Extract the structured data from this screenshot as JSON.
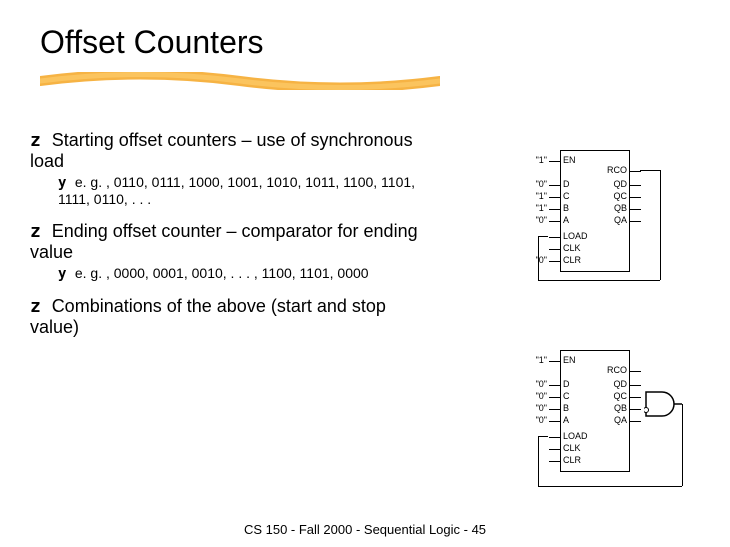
{
  "title": "Offset Counters",
  "bullets": {
    "b1": "Starting offset counters – use of synchronous load",
    "s1": "e. g. , 0110, 0111, 1000, 1001, 1010, 1011, 1100, 1101, 1111, 0110, . . .",
    "b2": "Ending offset counter – comparator for ending value",
    "s2": "e. g. , 0000, 0001, 0010, . . . , 1100, 1101, 0000",
    "b3": "Combinations of the above (start and stop value)"
  },
  "footer": "CS 150 - Fall  2000 - Sequential Logic - 45",
  "chip1": {
    "left_vals": {
      "en": "\"1\"",
      "d": "\"0\"",
      "c": "\"1\"",
      "b": "\"1\"",
      "a": "\"0\"",
      "clr": "\"0\""
    },
    "left_pins": {
      "en": "EN",
      "d": "D",
      "c": "C",
      "b": "B",
      "a": "A",
      "load": "LOAD",
      "clk": "CLK",
      "clr": "CLR"
    },
    "right_pins": {
      "rco": "RCO",
      "qd": "QD",
      "qc": "QC",
      "qb": "QB",
      "qa": "QA"
    }
  },
  "chip2": {
    "left_vals": {
      "en": "\"1\"",
      "d": "\"0\"",
      "c": "\"0\"",
      "b": "\"0\"",
      "a": "\"0\""
    },
    "left_pins": {
      "en": "EN",
      "d": "D",
      "c": "C",
      "b": "B",
      "a": "A",
      "load": "LOAD",
      "clk": "CLK",
      "clr": "CLR"
    },
    "right_pins": {
      "rco": "RCO",
      "qd": "QD",
      "qc": "QC",
      "qb": "QB",
      "qa": "QA"
    }
  }
}
